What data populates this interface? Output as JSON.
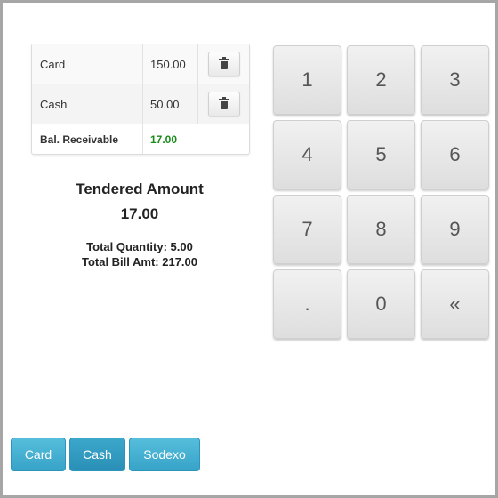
{
  "payments": {
    "rows": [
      {
        "method": "Card",
        "amount": "150.00",
        "delete_icon": "trash-icon"
      },
      {
        "method": "Cash",
        "amount": "50.00",
        "delete_icon": "trash-icon"
      }
    ],
    "balance": {
      "label": "Bal. Receivable",
      "amount": "17.00",
      "color": "#1a8a1a"
    }
  },
  "summary": {
    "title": "Tendered Amount",
    "amount": "17.00",
    "total_quantity": "Total Quantity: 5.00",
    "total_bill": "Total Bill Amt: 217.00"
  },
  "keypad": {
    "keys": [
      "1",
      "2",
      "3",
      "4",
      "5",
      "6",
      "7",
      "8",
      "9",
      ".",
      "0",
      "«"
    ]
  },
  "methods": {
    "buttons": [
      {
        "label": "Card",
        "active": false
      },
      {
        "label": "Cash",
        "active": true
      },
      {
        "label": "Sodexo",
        "active": false
      }
    ],
    "color": "#46b1d5"
  }
}
